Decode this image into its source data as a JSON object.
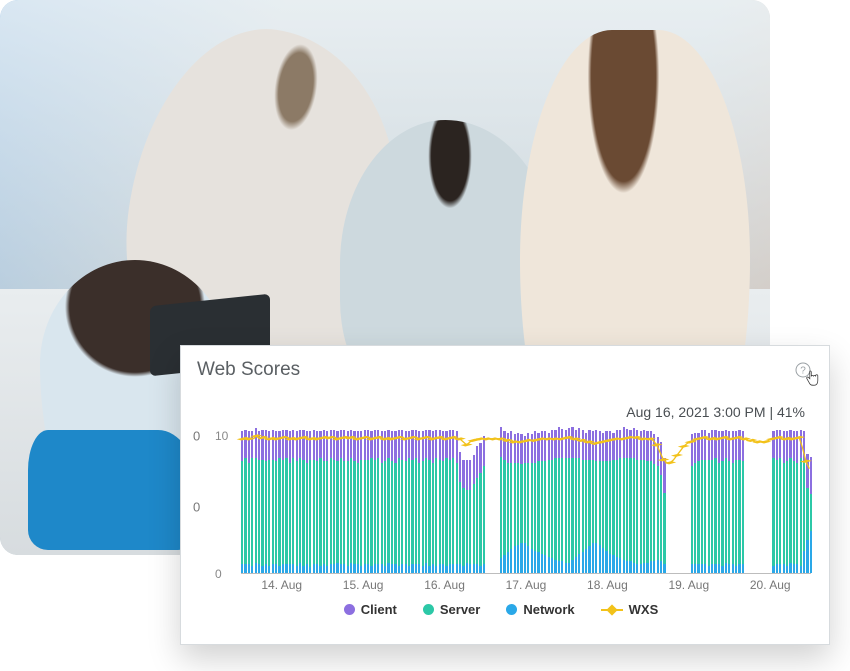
{
  "card": {
    "title": "Web Scores",
    "timestamp": "Aug 16, 2021 3:00 PM | 41%"
  },
  "chart_data": {
    "type": "bar",
    "title": "Web Scores",
    "xlabel": "",
    "ylabel": "",
    "ylim": [
      0,
      10
    ],
    "y_ticks_major": [
      0,
      0
    ],
    "y_ticks_minor": [
      0,
      10
    ],
    "categories": [
      "14. Aug",
      "15. Aug",
      "16. Aug",
      "17. Aug",
      "18. Aug",
      "19. Aug",
      "20. Aug"
    ],
    "series": [
      {
        "name": "Client",
        "color": "#8c6fe0"
      },
      {
        "name": "Server",
        "color": "#2cc8a7"
      },
      {
        "name": "Network",
        "color": "#2aa8e8"
      },
      {
        "name": "WXS",
        "color": "#f2c21a",
        "type": "line"
      }
    ],
    "annotation": "Aug 16, 2021 3:00 PM | 41%",
    "bins": [
      {
        "c": 2.0,
        "s": 6.9,
        "n": 0.6,
        "w": 9.0
      },
      {
        "c": 1.9,
        "s": 7.1,
        "n": 0.6,
        "w": 9.1
      },
      {
        "c": 2.1,
        "s": 6.8,
        "n": 0.6,
        "w": 9.0
      },
      {
        "c": 1.8,
        "s": 7.2,
        "n": 0.5,
        "w": 9.0
      },
      {
        "c": 2.0,
        "s": 7.0,
        "n": 0.7,
        "w": 9.2
      },
      {
        "c": 1.9,
        "s": 7.0,
        "n": 0.6,
        "w": 9.0
      },
      {
        "c": 2.0,
        "s": 7.1,
        "n": 0.5,
        "w": 9.1
      },
      {
        "c": 2.1,
        "s": 6.9,
        "n": 0.6,
        "w": 9.0
      },
      {
        "c": 1.9,
        "s": 7.1,
        "n": 0.5,
        "w": 9.0
      },
      {
        "c": 2.0,
        "s": 7.0,
        "n": 0.6,
        "w": 9.1
      },
      {
        "c": 2.0,
        "s": 6.9,
        "n": 0.6,
        "w": 9.0
      },
      {
        "c": 1.8,
        "s": 7.2,
        "n": 0.5,
        "w": 9.0
      },
      {
        "c": 2.0,
        "s": 7.0,
        "n": 0.6,
        "w": 9.1
      },
      {
        "c": 1.9,
        "s": 7.1,
        "n": 0.6,
        "w": 9.1
      },
      {
        "c": 2.1,
        "s": 6.8,
        "n": 0.6,
        "w": 9.0
      },
      {
        "c": 1.9,
        "s": 7.1,
        "n": 0.6,
        "w": 9.1
      },
      {
        "c": 2.0,
        "s": 7.0,
        "n": 0.5,
        "w": 9.0
      },
      {
        "c": 1.9,
        "s": 7.0,
        "n": 0.7,
        "w": 9.1
      },
      {
        "c": 2.0,
        "s": 7.1,
        "n": 0.5,
        "w": 9.1
      },
      {
        "c": 2.1,
        "s": 6.8,
        "n": 0.6,
        "w": 9.0
      },
      {
        "c": 1.9,
        "s": 7.2,
        "n": 0.4,
        "w": 9.0
      },
      {
        "c": 2.0,
        "s": 7.0,
        "n": 0.6,
        "w": 9.1
      },
      {
        "c": 2.0,
        "s": 6.9,
        "n": 0.6,
        "w": 9.0
      },
      {
        "c": 1.8,
        "s": 7.2,
        "n": 0.5,
        "w": 9.0
      },
      {
        "c": 2.1,
        "s": 6.9,
        "n": 0.6,
        "w": 9.1
      },
      {
        "c": 2.0,
        "s": 7.0,
        "n": 0.5,
        "w": 9.0
      },
      {
        "c": 1.9,
        "s": 7.1,
        "n": 0.6,
        "w": 9.1
      },
      {
        "c": 2.0,
        "s": 7.0,
        "n": 0.6,
        "w": 9.1
      },
      {
        "c": 2.0,
        "s": 6.8,
        "n": 0.7,
        "w": 9.0
      },
      {
        "c": 1.9,
        "s": 7.1,
        "n": 0.6,
        "w": 9.1
      },
      {
        "c": 2.1,
        "s": 6.9,
        "n": 0.6,
        "w": 9.1
      },
      {
        "c": 2.0,
        "s": 7.0,
        "n": 0.5,
        "w": 9.0
      },
      {
        "c": 1.9,
        "s": 7.0,
        "n": 0.7,
        "w": 9.1
      },
      {
        "c": 2.0,
        "s": 6.9,
        "n": 0.6,
        "w": 9.0
      },
      {
        "c": 2.1,
        "s": 6.8,
        "n": 0.6,
        "w": 9.0
      },
      {
        "c": 1.9,
        "s": 7.1,
        "n": 0.5,
        "w": 9.0
      },
      {
        "c": 2.0,
        "s": 7.0,
        "n": 0.6,
        "w": 9.1
      },
      {
        "c": 2.0,
        "s": 7.0,
        "n": 0.6,
        "w": 9.1
      },
      {
        "c": 1.8,
        "s": 7.2,
        "n": 0.5,
        "w": 9.0
      },
      {
        "c": 2.0,
        "s": 7.0,
        "n": 0.6,
        "w": 9.1
      },
      {
        "c": 1.9,
        "s": 7.1,
        "n": 0.6,
        "w": 9.1
      },
      {
        "c": 2.1,
        "s": 6.8,
        "n": 0.6,
        "w": 9.0
      },
      {
        "c": 2.0,
        "s": 7.0,
        "n": 0.5,
        "w": 9.0
      },
      {
        "c": 1.9,
        "s": 7.0,
        "n": 0.7,
        "w": 9.1
      },
      {
        "c": 2.0,
        "s": 6.9,
        "n": 0.6,
        "w": 9.0
      },
      {
        "c": 2.1,
        "s": 6.8,
        "n": 0.6,
        "w": 9.0
      },
      {
        "c": 1.9,
        "s": 7.2,
        "n": 0.5,
        "w": 9.1
      },
      {
        "c": 2.0,
        "s": 7.0,
        "n": 0.6,
        "w": 9.1
      },
      {
        "c": 2.0,
        "s": 6.9,
        "n": 0.6,
        "w": 9.0
      },
      {
        "c": 1.8,
        "s": 7.2,
        "n": 0.5,
        "w": 9.0
      },
      {
        "c": 2.0,
        "s": 7.0,
        "n": 0.6,
        "w": 9.1
      },
      {
        "c": 1.9,
        "s": 7.1,
        "n": 0.6,
        "w": 9.1
      },
      {
        "c": 2.1,
        "s": 6.8,
        "n": 0.6,
        "w": 9.0
      },
      {
        "c": 2.0,
        "s": 7.0,
        "n": 0.5,
        "w": 9.0
      },
      {
        "c": 1.9,
        "s": 7.0,
        "n": 0.7,
        "w": 9.1
      },
      {
        "c": 2.0,
        "s": 7.1,
        "n": 0.5,
        "w": 9.1
      },
      {
        "c": 2.1,
        "s": 6.8,
        "n": 0.6,
        "w": 9.0
      },
      {
        "c": 1.9,
        "s": 7.2,
        "n": 0.5,
        "w": 9.1
      },
      {
        "c": 2.0,
        "s": 7.0,
        "n": 0.6,
        "w": 9.1
      },
      {
        "c": 2.0,
        "s": 6.9,
        "n": 0.6,
        "w": 9.0
      },
      {
        "c": 1.8,
        "s": 7.2,
        "n": 0.5,
        "w": 9.0
      },
      {
        "c": 2.0,
        "s": 7.0,
        "n": 0.6,
        "w": 9.1
      },
      {
        "c": 1.9,
        "s": 7.1,
        "n": 0.6,
        "w": 9.1
      },
      {
        "c": 2.1,
        "s": 6.8,
        "n": 0.6,
        "w": 9.0
      },
      {
        "c": 2.0,
        "s": 5.5,
        "n": 0.6,
        "w": 9.0
      },
      {
        "c": 1.9,
        "s": 5.2,
        "n": 0.5,
        "w": 8.8
      },
      {
        "c": 2.0,
        "s": 4.9,
        "n": 0.7,
        "w": 8.6
      },
      {
        "c": 2.0,
        "s": 5.0,
        "n": 0.6,
        "w": 8.8
      },
      {
        "c": 1.9,
        "s": 5.4,
        "n": 0.6,
        "w": 8.9
      },
      {
        "c": 2.1,
        "s": 5.8,
        "n": 0.6,
        "w": 9.0
      },
      {
        "c": 2.0,
        "s": 6.2,
        "n": 0.5,
        "w": 9.0
      },
      {
        "c": 2.0,
        "s": 6.6,
        "n": 0.6,
        "w": 9.0
      },
      {
        "gap": true,
        "w": 9.0
      },
      {
        "gap": true,
        "w": 9.0
      },
      {
        "gap": true,
        "w": 9.0
      },
      {
        "gap": true,
        "w": 9.0
      },
      {
        "c": 2.0,
        "s": 6.8,
        "n": 1.0,
        "w": 9.0
      },
      {
        "c": 1.9,
        "s": 6.4,
        "n": 1.2,
        "w": 9.0
      },
      {
        "c": 2.0,
        "s": 6.0,
        "n": 1.4,
        "w": 8.9
      },
      {
        "c": 2.1,
        "s": 5.8,
        "n": 1.6,
        "w": 8.9
      },
      {
        "c": 1.9,
        "s": 5.6,
        "n": 1.8,
        "w": 8.8
      },
      {
        "c": 2.0,
        "s": 5.5,
        "n": 1.9,
        "w": 8.8
      },
      {
        "c": 2.0,
        "s": 5.3,
        "n": 2.0,
        "w": 8.8
      },
      {
        "c": 1.8,
        "s": 5.4,
        "n": 2.0,
        "w": 8.8
      },
      {
        "c": 2.0,
        "s": 5.6,
        "n": 1.8,
        "w": 8.9
      },
      {
        "c": 1.9,
        "s": 5.8,
        "n": 1.6,
        "w": 8.9
      },
      {
        "c": 2.1,
        "s": 5.9,
        "n": 1.5,
        "w": 8.9
      },
      {
        "c": 1.9,
        "s": 6.1,
        "n": 1.4,
        "w": 9.0
      },
      {
        "c": 2.0,
        "s": 6.2,
        "n": 1.3,
        "w": 9.0
      },
      {
        "c": 2.0,
        "s": 6.3,
        "n": 1.2,
        "w": 9.0
      },
      {
        "c": 1.8,
        "s": 6.5,
        "n": 1.1,
        "w": 9.0
      },
      {
        "c": 2.0,
        "s": 6.6,
        "n": 1.0,
        "w": 9.0
      },
      {
        "c": 1.9,
        "s": 6.8,
        "n": 0.9,
        "w": 9.0
      },
      {
        "c": 2.1,
        "s": 6.9,
        "n": 0.8,
        "w": 9.0
      },
      {
        "c": 2.0,
        "s": 6.9,
        "n": 0.8,
        "w": 9.0
      },
      {
        "c": 1.9,
        "s": 7.0,
        "n": 0.7,
        "w": 9.1
      },
      {
        "c": 2.0,
        "s": 7.0,
        "n": 0.7,
        "w": 9.1
      },
      {
        "c": 2.1,
        "s": 6.8,
        "n": 0.9,
        "w": 9.0
      },
      {
        "c": 1.9,
        "s": 6.6,
        "n": 1.1,
        "w": 9.0
      },
      {
        "c": 2.0,
        "s": 6.4,
        "n": 1.3,
        "w": 8.9
      },
      {
        "c": 2.0,
        "s": 6.2,
        "n": 1.4,
        "w": 8.9
      },
      {
        "c": 1.8,
        "s": 6.0,
        "n": 1.6,
        "w": 8.8
      },
      {
        "c": 2.0,
        "s": 5.8,
        "n": 1.8,
        "w": 8.8
      },
      {
        "c": 1.9,
        "s": 5.6,
        "n": 2.0,
        "w": 8.7
      },
      {
        "c": 2.1,
        "s": 5.5,
        "n": 2.0,
        "w": 8.7
      },
      {
        "c": 2.0,
        "s": 5.6,
        "n": 1.9,
        "w": 8.8
      },
      {
        "c": 1.9,
        "s": 5.8,
        "n": 1.7,
        "w": 8.8
      },
      {
        "c": 2.0,
        "s": 6.0,
        "n": 1.5,
        "w": 8.9
      },
      {
        "c": 2.0,
        "s": 6.2,
        "n": 1.3,
        "w": 8.9
      },
      {
        "c": 1.8,
        "s": 6.4,
        "n": 1.2,
        "w": 9.0
      },
      {
        "c": 2.0,
        "s": 6.5,
        "n": 1.1,
        "w": 9.0
      },
      {
        "c": 1.9,
        "s": 6.7,
        "n": 1.0,
        "w": 9.0
      },
      {
        "c": 2.1,
        "s": 6.8,
        "n": 0.9,
        "w": 9.0
      },
      {
        "c": 2.0,
        "s": 6.9,
        "n": 0.8,
        "w": 9.0
      },
      {
        "c": 1.9,
        "s": 6.9,
        "n": 0.8,
        "w": 9.1
      },
      {
        "c": 2.0,
        "s": 7.0,
        "n": 0.7,
        "w": 9.1
      },
      {
        "c": 2.0,
        "s": 7.0,
        "n": 0.6,
        "w": 9.1
      },
      {
        "c": 1.9,
        "s": 7.0,
        "n": 0.6,
        "w": 9.0
      },
      {
        "c": 2.0,
        "s": 6.9,
        "n": 0.7,
        "w": 9.0
      },
      {
        "c": 2.0,
        "s": 6.8,
        "n": 0.7,
        "w": 9.0
      },
      {
        "c": 2.0,
        "s": 6.7,
        "n": 0.8,
        "w": 9.0
      },
      {
        "c": 2.0,
        "s": 6.5,
        "n": 0.8,
        "w": 8.9
      },
      {
        "c": 1.9,
        "s": 6.3,
        "n": 0.9,
        "w": 8.6
      },
      {
        "c": 2.2,
        "s": 5.8,
        "n": 0.8,
        "w": 8.1
      },
      {
        "c": 2.3,
        "s": 4.8,
        "n": 0.6,
        "w": 7.6
      },
      {
        "gap": true,
        "w": 7.4
      },
      {
        "gap": true,
        "w": 7.4
      },
      {
        "gap": true,
        "w": 7.6
      },
      {
        "gap": true,
        "w": 7.9
      },
      {
        "gap": true,
        "w": 8.2
      },
      {
        "gap": true,
        "w": 8.5
      },
      {
        "gap": true,
        "w": 8.7
      },
      {
        "c": 2.1,
        "s": 6.6,
        "n": 0.6,
        "w": 8.8
      },
      {
        "c": 2.0,
        "s": 6.8,
        "n": 0.6,
        "w": 8.9
      },
      {
        "c": 1.9,
        "s": 6.9,
        "n": 0.6,
        "w": 9.0
      },
      {
        "c": 2.0,
        "s": 7.0,
        "n": 0.6,
        "w": 9.0
      },
      {
        "c": 2.0,
        "s": 7.0,
        "n": 0.6,
        "w": 9.1
      },
      {
        "c": 1.8,
        "s": 7.1,
        "n": 0.5,
        "w": 9.0
      },
      {
        "c": 2.0,
        "s": 7.0,
        "n": 0.6,
        "w": 9.0
      },
      {
        "c": 1.9,
        "s": 7.1,
        "n": 0.6,
        "w": 9.1
      },
      {
        "c": 2.1,
        "s": 6.8,
        "n": 0.6,
        "w": 9.0
      },
      {
        "c": 2.0,
        "s": 7.0,
        "n": 0.5,
        "w": 9.0
      },
      {
        "c": 1.9,
        "s": 7.0,
        "n": 0.7,
        "w": 9.1
      },
      {
        "c": 2.0,
        "s": 6.9,
        "n": 0.6,
        "w": 9.0
      },
      {
        "c": 2.1,
        "s": 6.8,
        "n": 0.6,
        "w": 9.0
      },
      {
        "c": 1.9,
        "s": 7.1,
        "n": 0.5,
        "w": 9.0
      },
      {
        "c": 2.0,
        "s": 7.0,
        "n": 0.6,
        "w": 9.1
      },
      {
        "c": 2.0,
        "s": 6.9,
        "n": 0.6,
        "w": 9.0
      },
      {
        "gap": true,
        "w": 9.0
      },
      {
        "gap": true,
        "w": 8.9
      },
      {
        "gap": true,
        "w": 8.9
      },
      {
        "gap": true,
        "w": 8.8
      },
      {
        "gap": true,
        "w": 8.8
      },
      {
        "gap": true,
        "w": 8.8
      },
      {
        "gap": true,
        "w": 8.8
      },
      {
        "gap": true,
        "w": 8.9
      },
      {
        "c": 1.8,
        "s": 7.2,
        "n": 0.5,
        "w": 9.0
      },
      {
        "c": 2.0,
        "s": 7.0,
        "n": 0.6,
        "w": 9.0
      },
      {
        "c": 1.9,
        "s": 7.1,
        "n": 0.6,
        "w": 9.1
      },
      {
        "c": 2.1,
        "s": 6.8,
        "n": 0.6,
        "w": 9.0
      },
      {
        "c": 2.0,
        "s": 7.0,
        "n": 0.5,
        "w": 9.0
      },
      {
        "c": 1.9,
        "s": 7.0,
        "n": 0.7,
        "w": 9.1
      },
      {
        "c": 2.0,
        "s": 6.9,
        "n": 0.6,
        "w": 9.0
      },
      {
        "c": 2.1,
        "s": 6.8,
        "n": 0.6,
        "w": 9.0
      },
      {
        "c": 1.9,
        "s": 7.2,
        "n": 0.5,
        "w": 9.1
      },
      {
        "c": 2.0,
        "s": 6.0,
        "n": 1.5,
        "w": 8.4
      },
      {
        "c": 2.3,
        "s": 3.5,
        "n": 2.2,
        "w": 7.5
      },
      {
        "c": 2.5,
        "s": 2.5,
        "n": 2.8,
        "w": 7.0
      }
    ]
  },
  "legend": {
    "client": "Client",
    "server": "Server",
    "network": "Network",
    "wxs": "WXS"
  }
}
